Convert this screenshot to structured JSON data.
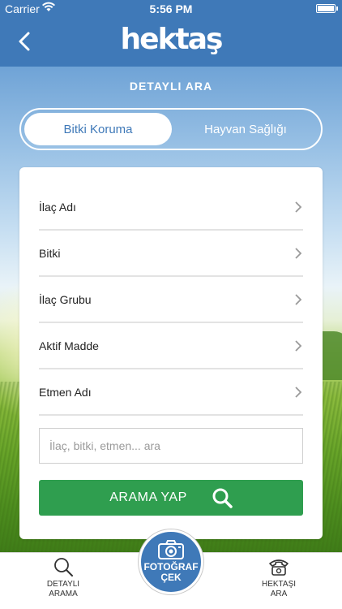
{
  "status_bar": {
    "carrier": "Carrier",
    "time": "5:56 PM",
    "wifi_icon": "wifi-icon",
    "battery_icon": "battery-icon"
  },
  "nav": {
    "back_icon": "back-arrow-icon",
    "logo_text": "hektaş"
  },
  "page_title": "DETAYLI ARA",
  "segments": [
    {
      "label": "Bitki Koruma",
      "selected": true
    },
    {
      "label": "Hayvan Sağlığı",
      "selected": false
    }
  ],
  "filters": [
    {
      "label": "İlaç Adı"
    },
    {
      "label": "Bitki"
    },
    {
      "label": "İlaç Grubu"
    },
    {
      "label": "Aktif Madde"
    },
    {
      "label": "Etmen Adı"
    }
  ],
  "search": {
    "placeholder": "İlaç, bitki, etmen... ara",
    "value": ""
  },
  "search_button": {
    "label": "ARAMA YAP",
    "icon": "search-icon"
  },
  "tab_bar": {
    "left": {
      "label_line1": "DETAYLI",
      "label_line2": "ARAMA",
      "icon": "search-icon"
    },
    "center": {
      "label_line1": "FOTOĞRAF",
      "label_line2": "ÇEK",
      "icon": "camera-icon"
    },
    "right": {
      "label_line1": "HEKTAŞI",
      "label_line2": "ARA",
      "icon": "phone-icon"
    }
  },
  "colors": {
    "primary_blue": "#3f79b8",
    "action_green": "#2f9e4f"
  }
}
